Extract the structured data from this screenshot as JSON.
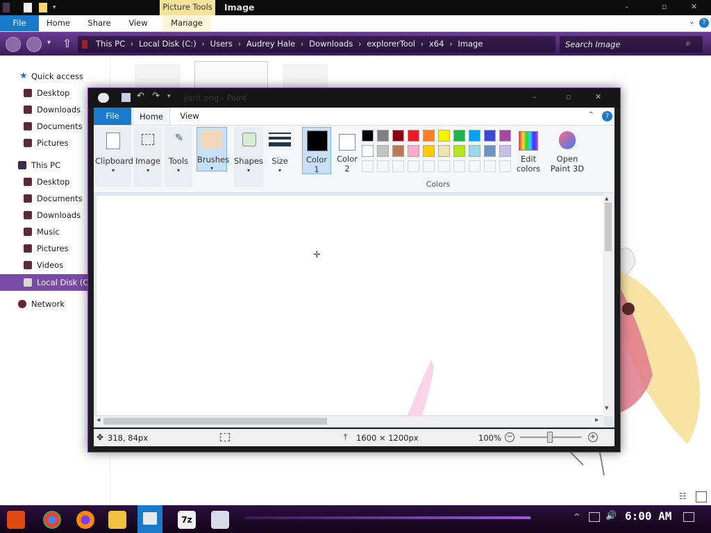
{
  "explorer": {
    "ribbon_context_tab": "Picture Tools",
    "window_title": "Image",
    "tabs": [
      "File",
      "Home",
      "Share",
      "View",
      "Manage"
    ],
    "breadcrumb": [
      "This PC",
      "Local Disk (C:)",
      "Users",
      "Audrey Hale",
      "Downloads",
      "explorerTool",
      "x64",
      "Image"
    ],
    "search_placeholder": "Search Image",
    "nav": {
      "quick_access": "Quick access",
      "qa_items": [
        "Desktop",
        "Downloads",
        "Documents",
        "Pictures"
      ],
      "this_pc": "This PC",
      "pc_items": [
        "Desktop",
        "Documents",
        "Downloads",
        "Music",
        "Pictures",
        "Videos"
      ],
      "local_disk": "Local Disk (C",
      "network": "Network"
    }
  },
  "paint": {
    "title": "jisrit.png - Paint",
    "tabs": [
      "File",
      "Home",
      "View"
    ],
    "groups": {
      "clipboard": "Clipboard",
      "image": "Image",
      "tools": "Tools",
      "brushes": "Brushes",
      "shapes": "Shapes",
      "size": "Size",
      "color1": "Color 1",
      "color2": "Color 2",
      "edit_colors": "Edit colors",
      "open_paint3d": "Open Paint 3D",
      "colors_group": "Colors"
    },
    "palette_row1": [
      "#000000",
      "#7f7f7f",
      "#880015",
      "#ed1c24",
      "#ff7f27",
      "#fff200",
      "#22b14c",
      "#00a2e8",
      "#3f48cc",
      "#a349a4"
    ],
    "palette_row2": [
      "#ffffff",
      "#c3c3c3",
      "#b97a57",
      "#ffaec9",
      "#ffc90e",
      "#efe4b0",
      "#b5e61d",
      "#99d9ea",
      "#7092be",
      "#c8bfe7"
    ],
    "status": {
      "cursor_pos": "318, 84px",
      "image_size": "1600 × 1200px",
      "zoom": "100%"
    }
  },
  "taskbar": {
    "time": "6:00 AM"
  },
  "colors": {
    "accent": "#7a4aa6",
    "file_tab": "#1979ca"
  }
}
